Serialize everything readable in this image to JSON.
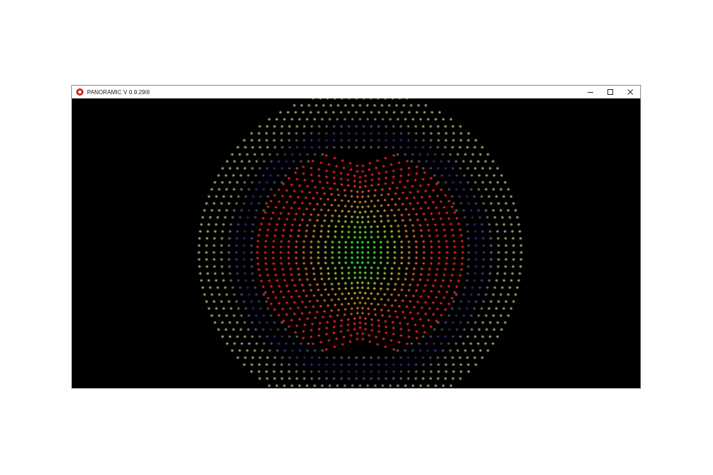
{
  "window": {
    "title": "PANORAMIC V 0.9.29i9",
    "app_icon": "panoramic-app-icon",
    "controls": [
      {
        "name": "minimize",
        "icon": "minimize-icon"
      },
      {
        "name": "maximize",
        "icon": "maximize-icon"
      },
      {
        "name": "close",
        "icon": "close-icon"
      }
    ]
  },
  "canvas": {
    "background": "#000000",
    "colors": {
      "outer_sphere": "#b9b47a",
      "ring_band": "#2a2f9a",
      "inner_sphere": "#ff2222",
      "core": "#33ff33"
    }
  }
}
